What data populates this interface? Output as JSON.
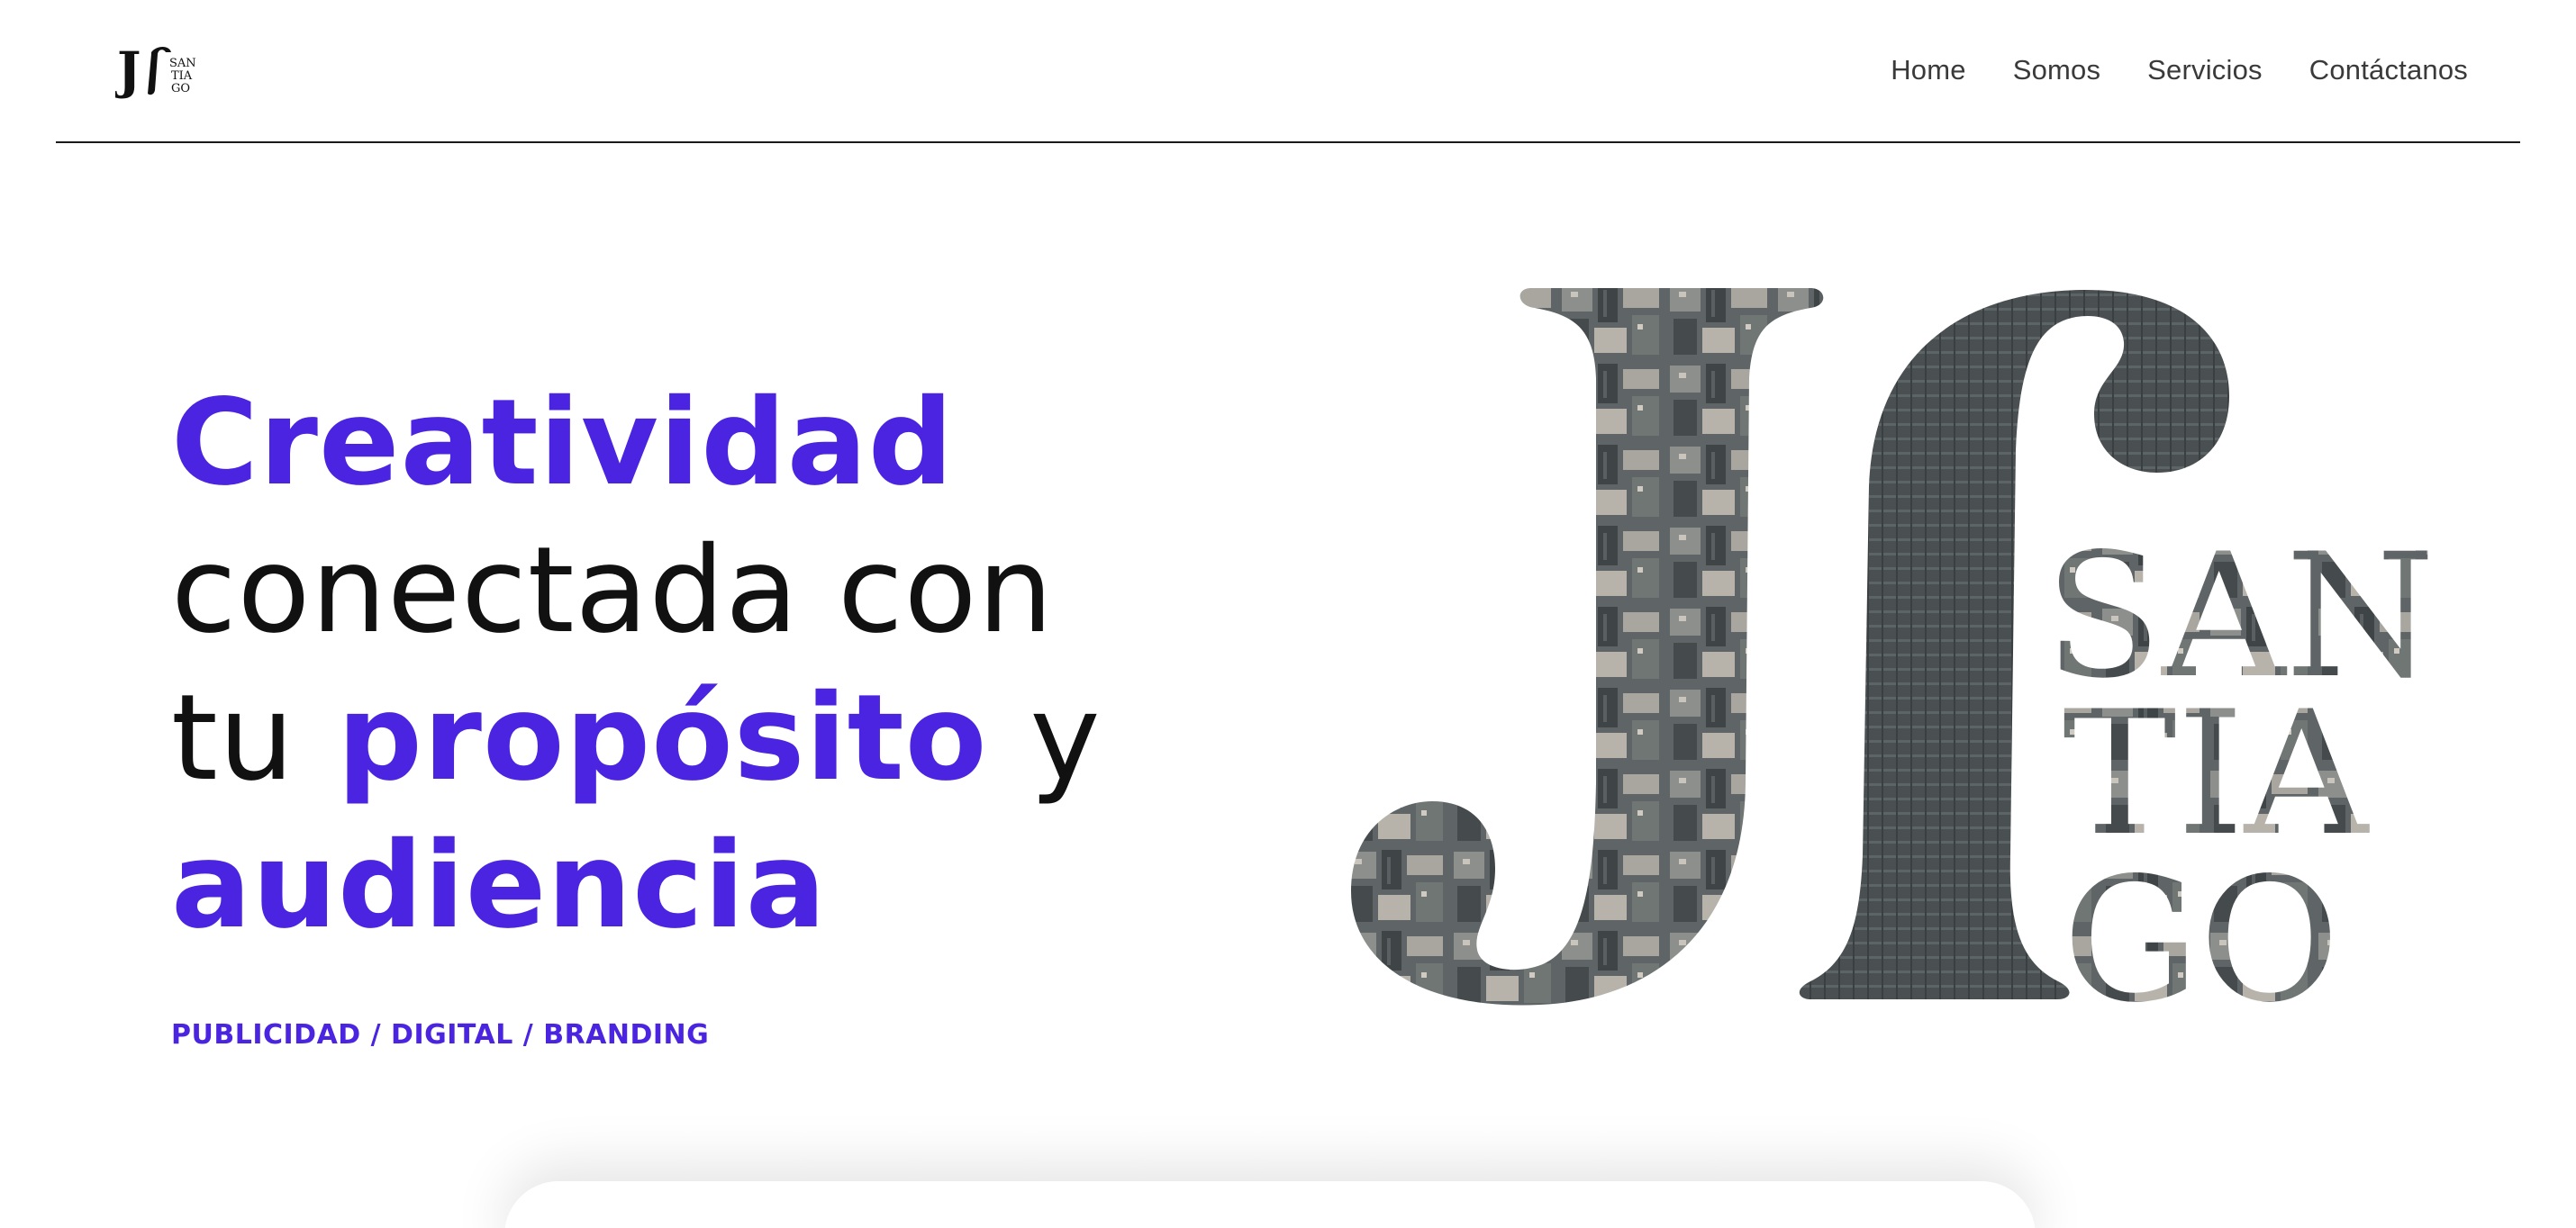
{
  "brand": {
    "logo_letters": "J",
    "logo_words": [
      "SAN",
      "TIA",
      "GO"
    ],
    "accent_color": "#4a24e0",
    "text_color": "#111111"
  },
  "nav": {
    "items": [
      {
        "label": "Home"
      },
      {
        "label": "Somos"
      },
      {
        "label": "Servicios"
      },
      {
        "label": "Contáctanos"
      }
    ]
  },
  "hero": {
    "line1_accent": "Creatividad",
    "line2_plain": "conectada con",
    "line3_plain_before": "tu",
    "line3_accent": "propósito",
    "line3_plain_after": "y",
    "line4_accent": "audiencia",
    "tagline": "PUBLICIDAD / DIGITAL / BRANDING"
  }
}
